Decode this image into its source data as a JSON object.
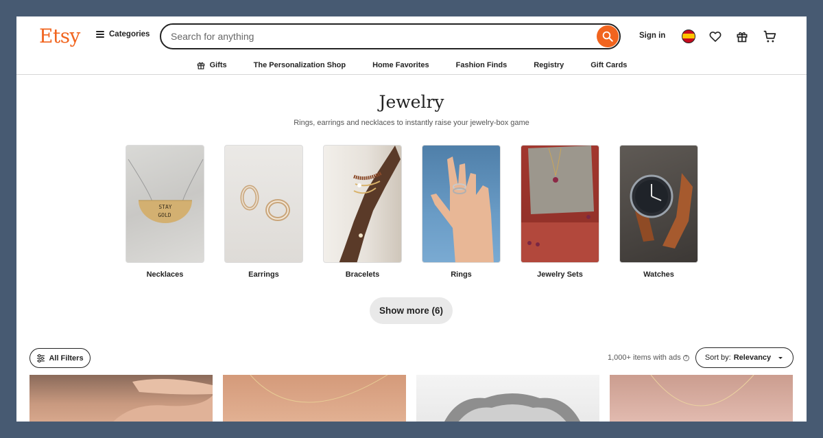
{
  "header": {
    "logo": "Etsy",
    "categories_label": "Categories",
    "search_placeholder": "Search for anything",
    "sign_in": "Sign in"
  },
  "subnav": [
    {
      "label": "Gifts",
      "icon": "gift-icon"
    },
    {
      "label": "The Personalization Shop"
    },
    {
      "label": "Home Favorites"
    },
    {
      "label": "Fashion Finds"
    },
    {
      "label": "Registry"
    },
    {
      "label": "Gift Cards"
    }
  ],
  "hero": {
    "title": "Jewelry",
    "subtitle": "Rings, earrings and necklaces to instantly raise your jewelry-box game"
  },
  "categories": [
    {
      "label": "Necklaces",
      "pendant_text_1": "STAY",
      "pendant_text_2": "GOLD"
    },
    {
      "label": "Earrings"
    },
    {
      "label": "Bracelets"
    },
    {
      "label": "Rings"
    },
    {
      "label": "Jewelry Sets"
    },
    {
      "label": "Watches"
    }
  ],
  "show_more": "Show more (6)",
  "toolbar": {
    "filters_label": "All Filters",
    "results_text": "1,000+ items with ads",
    "sort_prefix": "Sort by:",
    "sort_value": "Relevancy"
  },
  "colors": {
    "brand": "#f1641e",
    "background_frame": "#475a72"
  }
}
